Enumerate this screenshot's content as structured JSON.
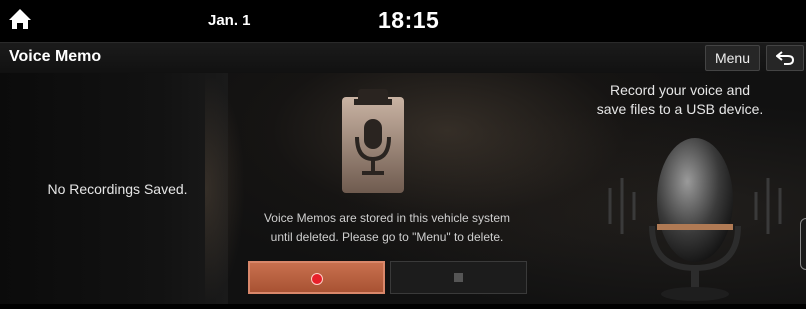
{
  "status_bar": {
    "date": "Jan. 1",
    "time": "18:15",
    "home_icon": "home-icon"
  },
  "header": {
    "title": "Voice Memo",
    "menu_label": "Menu",
    "back_icon": "back-arrow-icon"
  },
  "recordings": {
    "empty_text": "No Recordings Saved."
  },
  "main": {
    "tagline_line1": "Record your voice and",
    "tagline_line2": "save files to a USB device.",
    "info_line1": "Voice Memos are stored in this vehicle system",
    "info_line2": "until deleted. Please go to \"Menu\" to delete."
  },
  "controls": {
    "record_icon": "record-icon",
    "stop_icon": "stop-icon"
  },
  "colors": {
    "accent": "#b85c3c",
    "record_dot": "#e8202a"
  }
}
